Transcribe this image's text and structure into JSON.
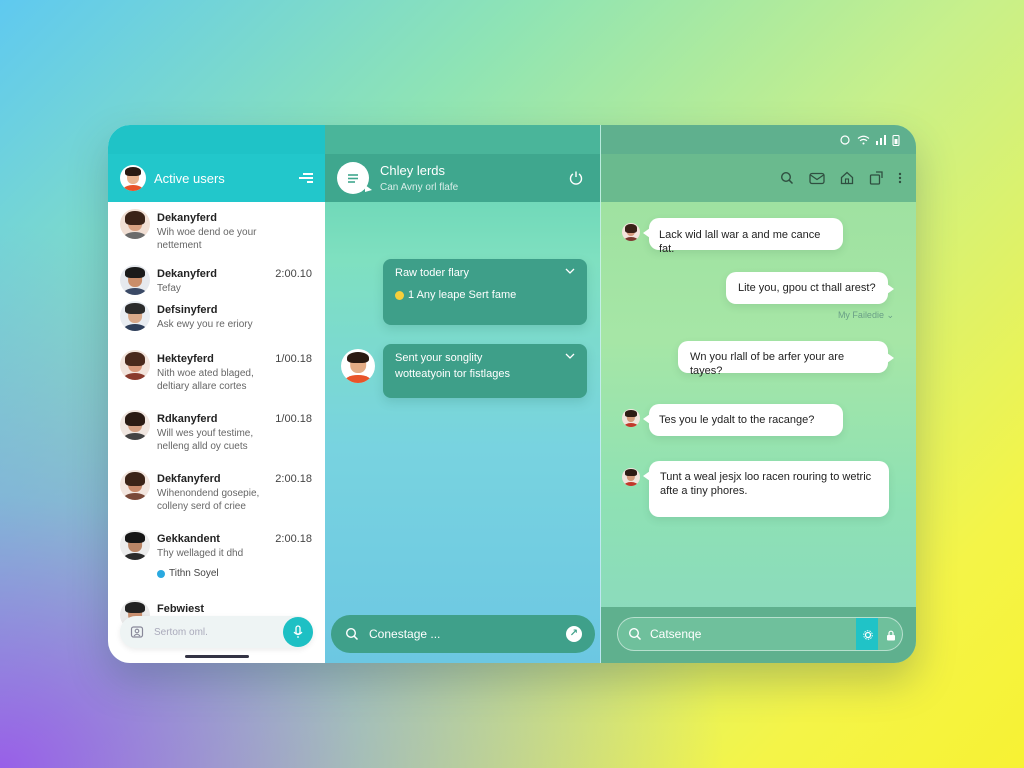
{
  "left": {
    "header_title": "Active users",
    "contacts": [
      {
        "name": "Dekanyferd",
        "time": "",
        "msg": "Wih woe dend oe your nettement"
      },
      {
        "name": "Dekanyferd",
        "time": "2:00.10",
        "msg": "Tefay"
      },
      {
        "name": "Defsinyferd",
        "time": "",
        "msg": "Ask ewy you re eriory"
      },
      {
        "name": "Hekteyferd",
        "time": "1/00.18",
        "msg": "Nith woe ated blaged, deltiary allare cortes"
      },
      {
        "name": "Rdkanyferd",
        "time": "1/00.18",
        "msg": "Will wes youf testime, nelleng alld oy cuets"
      },
      {
        "name": "Dekfanyferd",
        "time": "2:00.18",
        "msg": "Wihenondend gosepie, colleny serd of criee"
      },
      {
        "name": "Gekkandent",
        "time": "2:00.18",
        "msg": "Thy wellaged it dhd",
        "extra": "Tithn Soyel"
      },
      {
        "name": "Febwiest",
        "time": "",
        "msg": ""
      }
    ],
    "search_placeholder": "Sertom oml."
  },
  "middle": {
    "title": "Chley lerds",
    "subtitle": "Can Avny orl flafe",
    "cards": [
      {
        "line1": "Raw toder flary",
        "line2": "1 Any leape Sert fame"
      },
      {
        "line1": "Sent your songlity",
        "line2": "wotteatyoin tor fistlages"
      }
    ],
    "search_placeholder": "Conestage ..."
  },
  "right": {
    "messages": [
      {
        "dir": "in",
        "text": "Lack wid lall war a and me cance fat."
      },
      {
        "dir": "out",
        "text": "Lite you, gpou ct thall arest?"
      },
      {
        "dir": "out",
        "text": "Wn you rlall of be arfer your are tayes?"
      },
      {
        "dir": "in",
        "text": "Tes you le ydalt to the racange?"
      },
      {
        "dir": "in",
        "text": "Tunt a weal jesjx loo racen rouring to wetric afte a tiny phores."
      }
    ],
    "seen_label": "My Failedie",
    "search_placeholder": "Catsenqe"
  },
  "colors": {
    "accent": "#22c7cb",
    "middle_header": "#3fa78e",
    "card": "#3e9f89",
    "right_header": "#6aba8e"
  }
}
